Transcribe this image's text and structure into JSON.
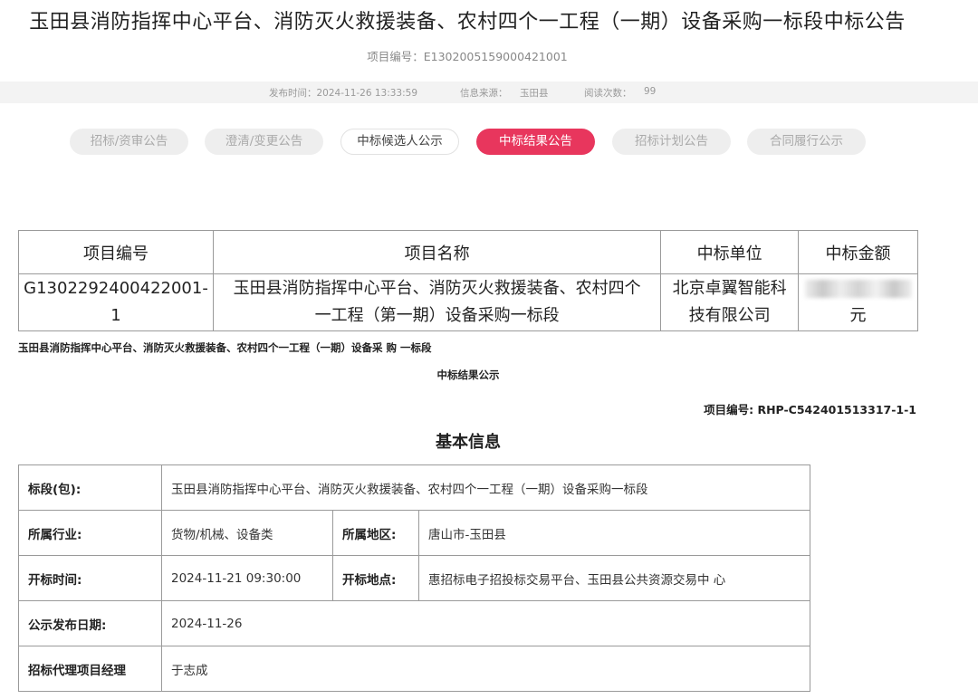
{
  "page": {
    "title": "玉田县消防指挥中心平台、消防灭火救援装备、农村四个一工程（一期）设备采购一标段中标公告",
    "project_no": "项目编号：E1302005159000421001"
  },
  "meta": {
    "publish_time": "发布时间：2024-11-26 13:33:59",
    "source_label": "信息来源：",
    "source": "玉田县",
    "views_label": "阅读次数：",
    "views": "99"
  },
  "tabs": [
    {
      "label": "招标/资审公告"
    },
    {
      "label": "澄清/变更公告"
    },
    {
      "label": "中标候选人公示"
    },
    {
      "label": "中标结果公告"
    },
    {
      "label": "招标计划公告"
    },
    {
      "label": "合同履行公示"
    }
  ],
  "award_table": {
    "headers": [
      "项目编号",
      "项目名称",
      "中标单位",
      "中标金额"
    ],
    "row": {
      "code_line1": "G1302292400422001-",
      "code_line2": "1",
      "name_line1": "玉田县消防指挥中心平台、消防灭火救援装备、农村四个",
      "name_line2": "一工程（第一期）设备采购一标段",
      "winner_line1": "北京卓翼智能科",
      "winner_line2": "技有限公司",
      "amount_unit": "元"
    }
  },
  "notice": {
    "project_line": "玉田县消防指挥中心平台、消防灭火救援装备、农村四个一工程（一期）设备采 购 一标段",
    "result_title": "中标结果公示",
    "project_code": "项目编号: RHP-C542401513317-1-1",
    "basic_info_title": "基本信息"
  },
  "basic_info": {
    "lot_label": "标段(包):",
    "lot_value": "玉田县消防指挥中心平台、消防灭火救援装备、农村四个一工程（一期）设备采购一标段",
    "industry_label": "所属行业:",
    "industry_value": "货物/机械、设备类",
    "region_label": "所属地区:",
    "region_value": "唐山市-玉田县",
    "open_time_label": "开标时间:",
    "open_time_value": "2024-11-21 09:30:00",
    "open_place_label": "开标地点:",
    "open_place_value": "惠招标电子招投标交易平台、玉田县公共资源交易中 心",
    "publish_date_label": "公示发布日期:",
    "publish_date_value": "2024-11-26",
    "manager_label": "招标代理项目经理",
    "manager_value": "于志成"
  },
  "colors": {
    "active_tab": "#e8365d",
    "inactive_tab": "#eeeeee",
    "meta_bar": "#f3f3f3"
  }
}
